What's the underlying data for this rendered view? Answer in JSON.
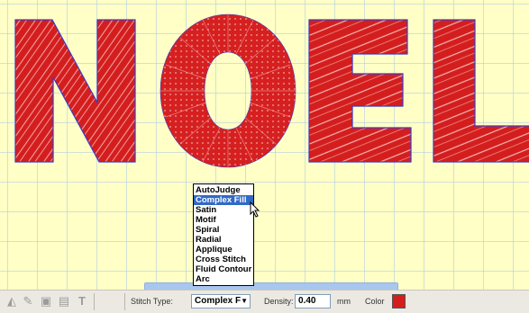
{
  "colors": {
    "embroidery": "#d41e1e",
    "outline": "#3a3ac8",
    "selection": "#316ac5",
    "grid": "#aac8e6",
    "canvas": "#ffffc6"
  },
  "dropdown": {
    "options": [
      "AutoJudge",
      "Complex Fill",
      "Satin",
      "Motif",
      "Spiral",
      "Radial",
      "Applique",
      "Cross Stitch",
      "Fluid Contour",
      "Arc"
    ],
    "selected": "Complex Fill"
  },
  "toolbar": {
    "icons": [
      "shape-tool-icon",
      "node-tool-icon",
      "image-tool-icon",
      "text-tool-icon"
    ],
    "stitch_type_label": "Stitch Type:",
    "stitch_type_value": "Complex F",
    "density_label": "Density:",
    "density_value": "0.40",
    "density_unit": "mm",
    "color_label": "Color"
  }
}
